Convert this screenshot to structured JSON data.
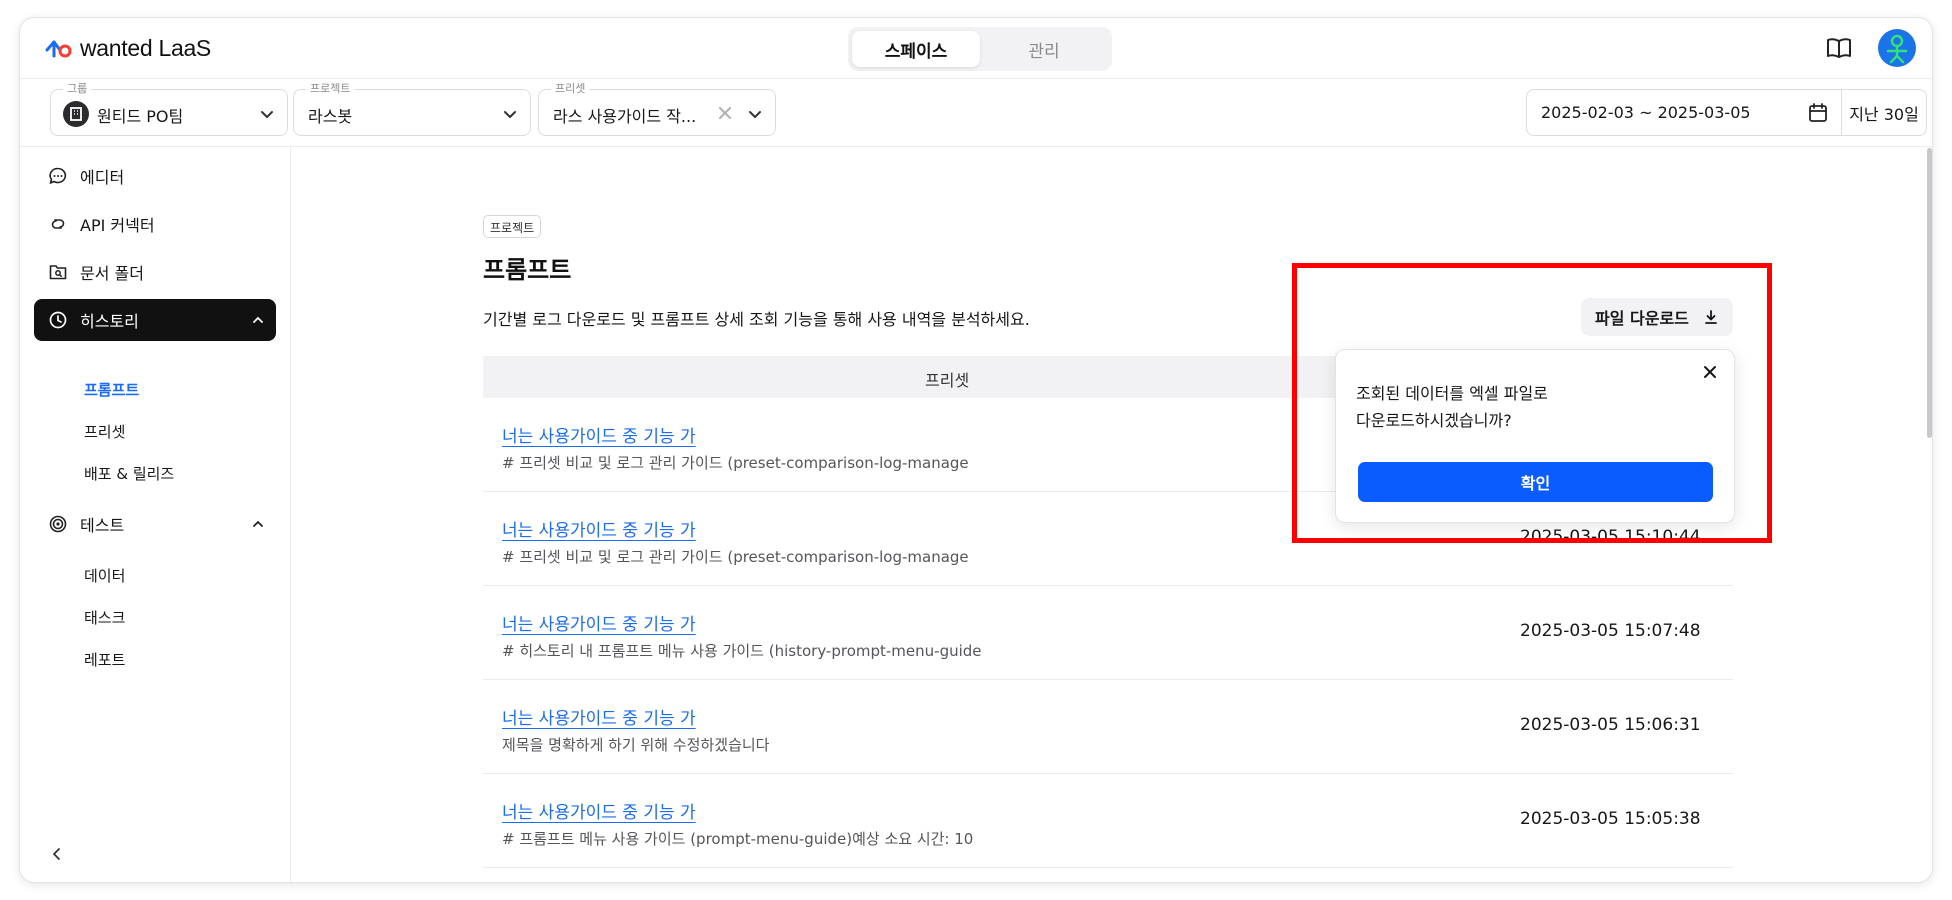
{
  "header": {
    "logo_text": "wanted LaaS",
    "tabs": [
      {
        "label": "스페이스",
        "active": true
      },
      {
        "label": "관리",
        "active": false
      }
    ]
  },
  "filters": {
    "group": {
      "label": "그룹",
      "value": "원티드 PO팀"
    },
    "project": {
      "label": "프로젝트",
      "value": "라스봇"
    },
    "preset": {
      "label": "프리셋",
      "value": "라스 사용가이드 작..."
    },
    "date_range": "2025-02-03 ~ 2025-03-05",
    "last_days": "지난 30일"
  },
  "sidebar": {
    "items": [
      {
        "label": "에디터"
      },
      {
        "label": "API 커넥터"
      },
      {
        "label": "문서 폴더"
      },
      {
        "label": "히스토리",
        "active": true
      },
      {
        "label": "테스트"
      }
    ],
    "history_sub": [
      {
        "label": "프롬프트",
        "active": true
      },
      {
        "label": "프리셋"
      },
      {
        "label": "배포 & 릴리즈"
      }
    ],
    "test_sub": [
      {
        "label": "데이터"
      },
      {
        "label": "태스크"
      },
      {
        "label": "레포트"
      }
    ]
  },
  "main": {
    "badge": "프로젝트",
    "title": "프롬프트",
    "description": "기간별 로그 다운로드 및 프롬프트 상세 조회 기능을 통해 사용 내역을 분석하세요.",
    "download_button": "파일 다운로드",
    "table": {
      "column_header": "프리셋",
      "rows": [
        {
          "title": "너는 사용가이드 중 기능 가",
          "subtitle": "# 프리셋 비교 및 로그 관리 가이드 (preset-comparison-log-manage",
          "date": ""
        },
        {
          "title": "너는 사용가이드 중 기능 가",
          "subtitle": "# 프리셋 비교 및 로그 관리 가이드 (preset-comparison-log-manage",
          "date": "2025-03-05 15:10:44"
        },
        {
          "title": "너는 사용가이드 중 기능 가",
          "subtitle": "# 히스토리 내 프롬프트 메뉴 사용 가이드 (history-prompt-menu-guide",
          "date": "2025-03-05 15:07:48"
        },
        {
          "title": "너는 사용가이드 중 기능 가",
          "subtitle": "제목을 명확하게 하기 위해 수정하겠습니다",
          "date": "2025-03-05 15:06:31"
        },
        {
          "title": "너는 사용가이드 중 기능 가",
          "subtitle": "# 프롬프트 메뉴 사용 가이드 (prompt-menu-guide)예상 소요 시간: 10",
          "date": "2025-03-05 15:05:38"
        }
      ]
    }
  },
  "popover": {
    "line1": "조회된 데이터를 엑셀 파일로",
    "line2": "다운로드하시겠습니까?",
    "confirm_label": "확인"
  },
  "colors": {
    "accent": "#1a6cf5",
    "confirm": "#0b5cff",
    "highlight": "#ff0000"
  }
}
